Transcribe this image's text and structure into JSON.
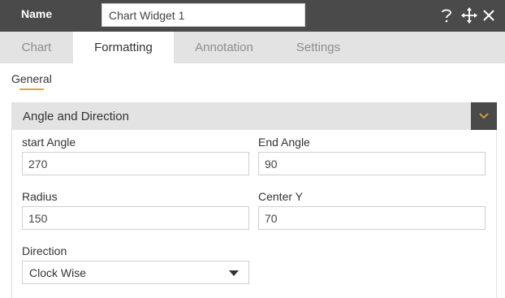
{
  "header": {
    "name_label": "Name",
    "name_value": "Chart Widget 1",
    "help_icon": "question-icon",
    "move_icon": "move-icon",
    "close_icon": "close-icon"
  },
  "tabs": [
    {
      "label": "Chart",
      "active": false
    },
    {
      "label": "Formatting",
      "active": true
    },
    {
      "label": "Annotation",
      "active": false
    },
    {
      "label": "Settings",
      "active": false
    }
  ],
  "subtab": {
    "label": "General"
  },
  "section": {
    "title": "Angle and Direction",
    "toggle_icon": "chevron-down-icon",
    "fields": {
      "start_angle": {
        "label": "start Angle",
        "value": "270"
      },
      "end_angle": {
        "label": "End Angle",
        "value": "90"
      },
      "radius": {
        "label": "Radius",
        "value": "150"
      },
      "center_y": {
        "label": "Center Y",
        "value": "70"
      },
      "direction": {
        "label": "Direction",
        "value": "Clock Wise"
      }
    }
  },
  "colors": {
    "header_bg": "#4a4a4a",
    "tab_bar_bg": "#e3e3e3",
    "accent": "#e3a23b"
  }
}
